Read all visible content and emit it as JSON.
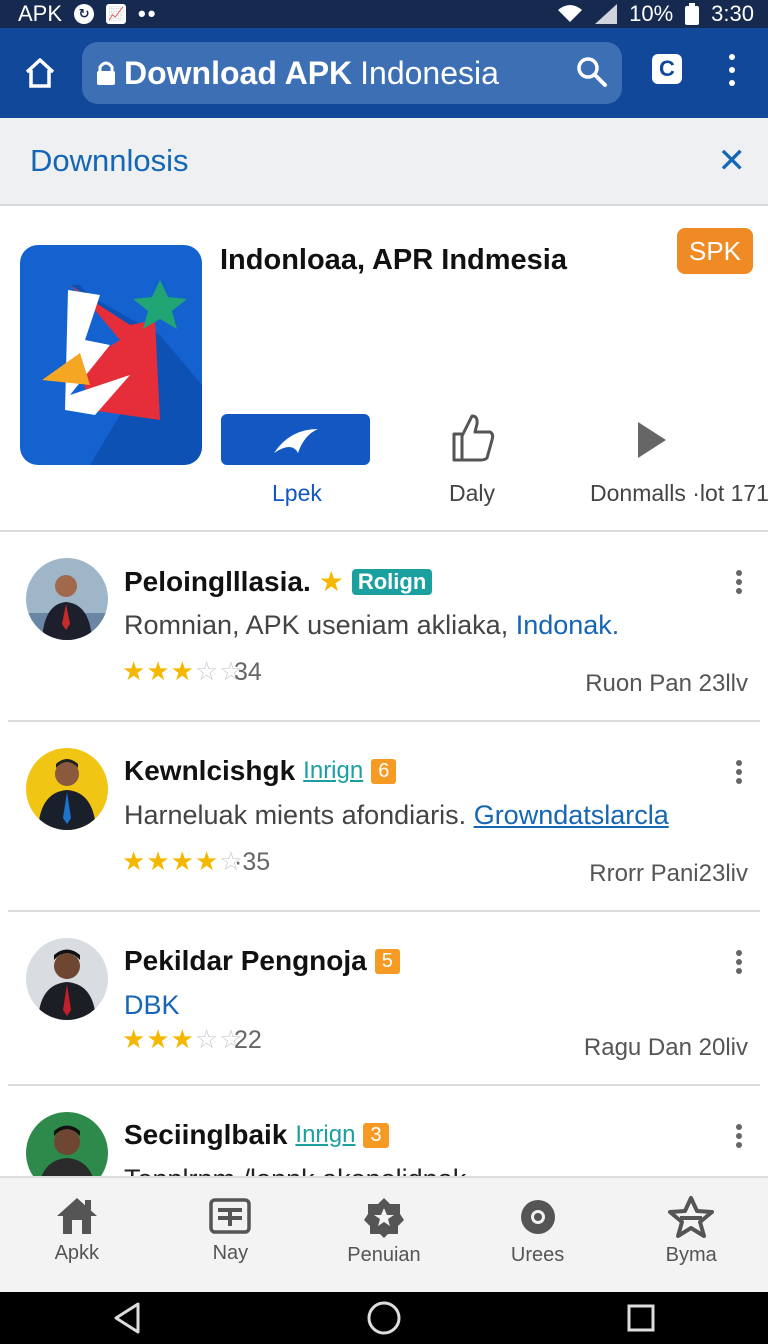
{
  "status_bar": {
    "left_text": "APK",
    "battery": "10%",
    "time": "3:30"
  },
  "browser": {
    "url_bold": "Download APK",
    "url_rest": "Indonesia"
  },
  "sub_header": {
    "title": "Downnlosis"
  },
  "app": {
    "title": "Indonloaa, APR Indmesia",
    "badge": "SPK",
    "actions": {
      "install_label": "Lpek",
      "like_label": "Daly",
      "downloads_label": "Donmalls ·lot 171"
    }
  },
  "reviews": [
    {
      "name": "Peloinglllasia.",
      "tag": "Rolign",
      "body": "Romnian, APK useniam akliaka,",
      "link": "Indonak.",
      "stars": 3,
      "count": "34",
      "date": "Ruon Pan 23llv"
    },
    {
      "name": "Kewnlcishgk",
      "tag": "Inrign",
      "badge": "6",
      "body": "Harneluak mients afondiaris.",
      "link": "Growndatslarcla",
      "stars": 4,
      "count": "·35",
      "date": "Rrorr Pani23liv"
    },
    {
      "name": "Pekildar Pengnoja",
      "badge": "5",
      "body": "",
      "link": "DBK",
      "stars": 3,
      "count": "22",
      "date": "Ragu Dan 20liv"
    },
    {
      "name": "Seciinglbaik",
      "tag": "Inrign",
      "badge": "3",
      "body": "Tenplrnm /lonnk akonolidnak"
    }
  ],
  "bottom_nav": [
    {
      "label": "Apkk",
      "icon": "home-icon"
    },
    {
      "label": "Nay",
      "icon": "news-icon"
    },
    {
      "label": "Penuian",
      "icon": "badge-icon"
    },
    {
      "label": "Urees",
      "icon": "settings-icon"
    },
    {
      "label": "Byma",
      "icon": "star-icon"
    }
  ],
  "colors": {
    "browser_bar": "#11489a",
    "accent_blue": "#1566b5",
    "badge_orange": "#f08a24",
    "star_gold": "#f5b800"
  }
}
